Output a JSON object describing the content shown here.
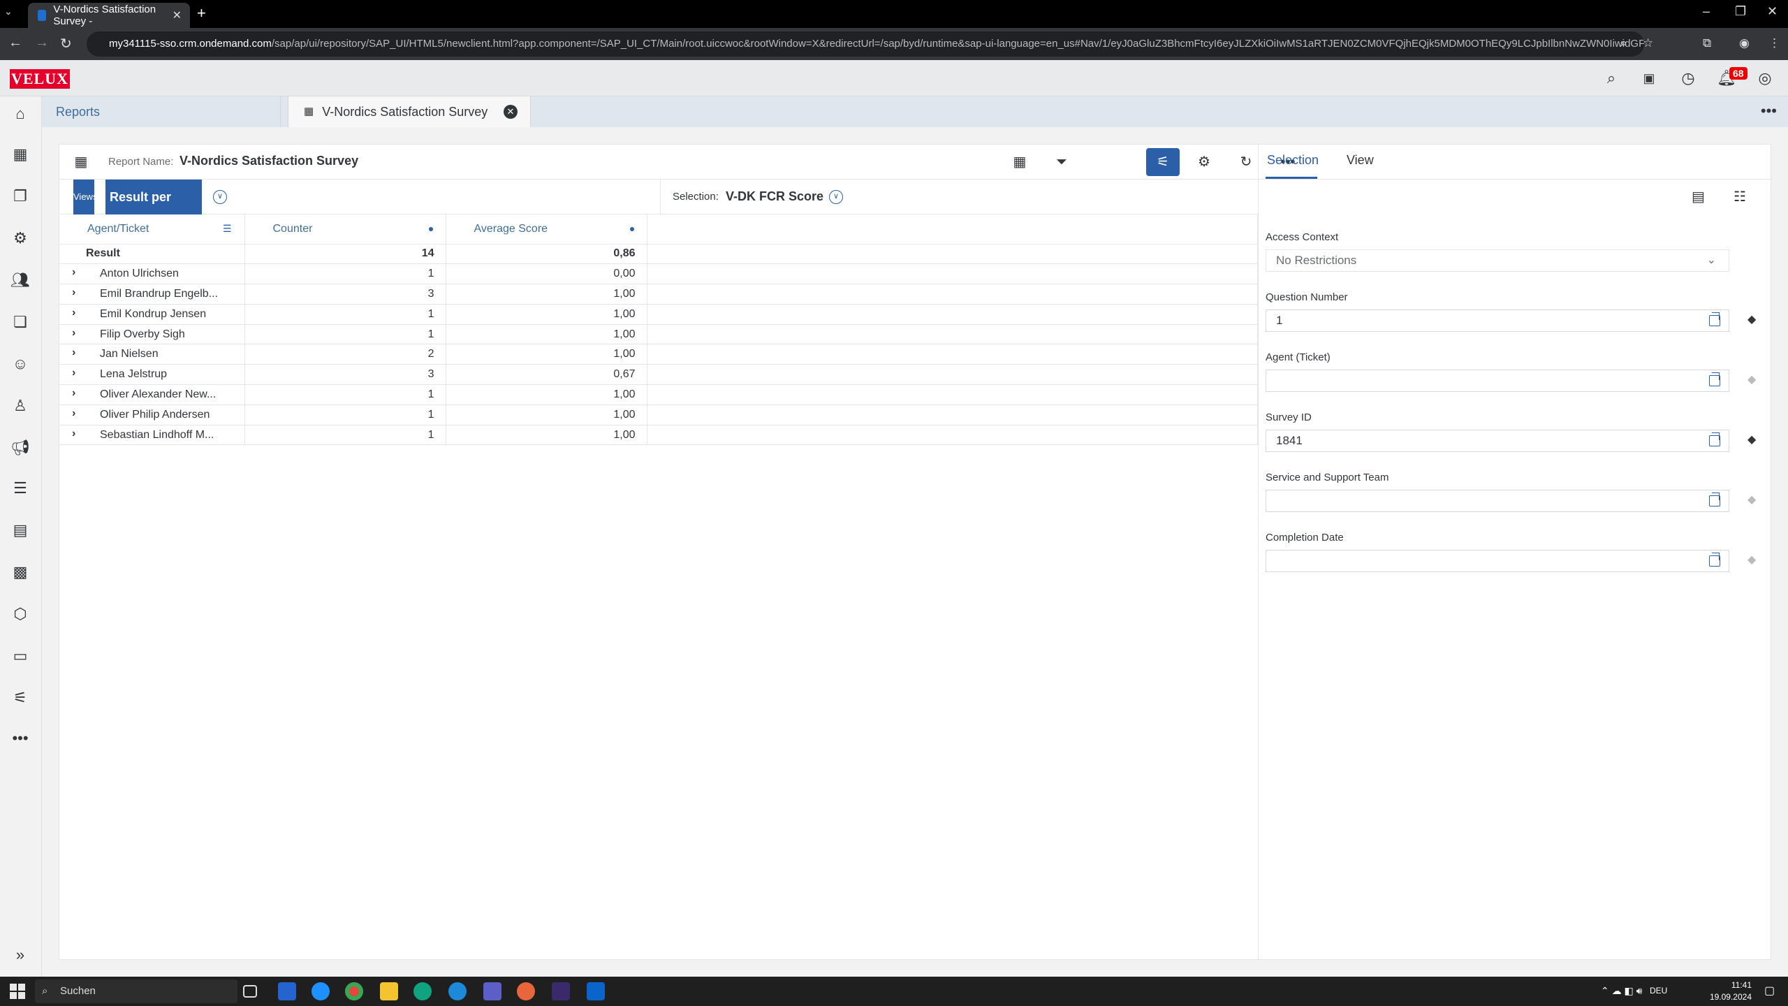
{
  "browser": {
    "tab_title": "V-Nordics Satisfaction Survey - ",
    "url_host": "my341115-sso.crm.ondemand.com",
    "url_path": "/sap/ap/ui/repository/SAP_UI/HTML5/newclient.html?app.component=/SAP_UI_CT/Main/root.uiccwoc&rootWindow=X&redirectUrl=/sap/byd/runtime&sap-ui-language=en_us#Nav/1/eyJ0aGluZ3BhcmFtcyI6eyJLZXkiOiIwMS1aRTJEN0ZCM0VFQjhEQjk5MDM0OThEQy9LCJpbIlbnNwZWN0IiwidGFyZ2V0Il..."
  },
  "shell": {
    "logo": "VELUX",
    "notification_count": "68"
  },
  "page_tabs": {
    "reports": "Reports",
    "survey": "V-Nordics Satisfaction Survey"
  },
  "report": {
    "name_label": "Report Name:",
    "name": "V-Nordics Satisfaction Survey",
    "view_chip": "Views",
    "view_name": "Result per Agent",
    "selection_label": "Selection:",
    "selection_name": "V-DK FCR Score"
  },
  "table": {
    "headers": [
      "Agent/Ticket",
      "Counter",
      "Average Score"
    ],
    "result_row": {
      "label": "Result",
      "counter": "14",
      "avg": "0,86"
    },
    "rows": [
      {
        "name": "Anton Ulrichsen",
        "counter": "1",
        "avg": "0,00"
      },
      {
        "name": "Emil Brandrup Engelb...",
        "counter": "3",
        "avg": "1,00"
      },
      {
        "name": "Emil Kondrup Jensen",
        "counter": "1",
        "avg": "1,00"
      },
      {
        "name": "Filip Overby Sigh",
        "counter": "1",
        "avg": "1,00"
      },
      {
        "name": "Jan Nielsen",
        "counter": "2",
        "avg": "1,00"
      },
      {
        "name": "Lena Jelstrup",
        "counter": "3",
        "avg": "0,67"
      },
      {
        "name": "Oliver Alexander New...",
        "counter": "1",
        "avg": "1,00"
      },
      {
        "name": "Oliver Philip Andersen",
        "counter": "1",
        "avg": "1,00"
      },
      {
        "name": "Sebastian Lindhoff M...",
        "counter": "1",
        "avg": "1,00"
      }
    ]
  },
  "right_panel": {
    "tabs": [
      "Selection",
      "View"
    ],
    "fields": {
      "access_context": {
        "label": "Access Context",
        "value": "No Restrictions"
      },
      "question_number": {
        "label": "Question Number",
        "value": "1"
      },
      "agent_ticket": {
        "label": "Agent (Ticket)",
        "value": ""
      },
      "survey_id": {
        "label": "Survey ID",
        "value": "1841"
      },
      "service_team": {
        "label": "Service and Support Team",
        "value": ""
      },
      "completion_date": {
        "label": "Completion Date",
        "value": ""
      }
    }
  },
  "taskbar": {
    "search": "Suchen",
    "lang": "DEU",
    "time": "11:41",
    "date": "19.09.2024"
  },
  "colors": {
    "brand_red": "#e4002b",
    "sap_blue": "#2b5fa8",
    "header_link": "#3f6e9c"
  }
}
